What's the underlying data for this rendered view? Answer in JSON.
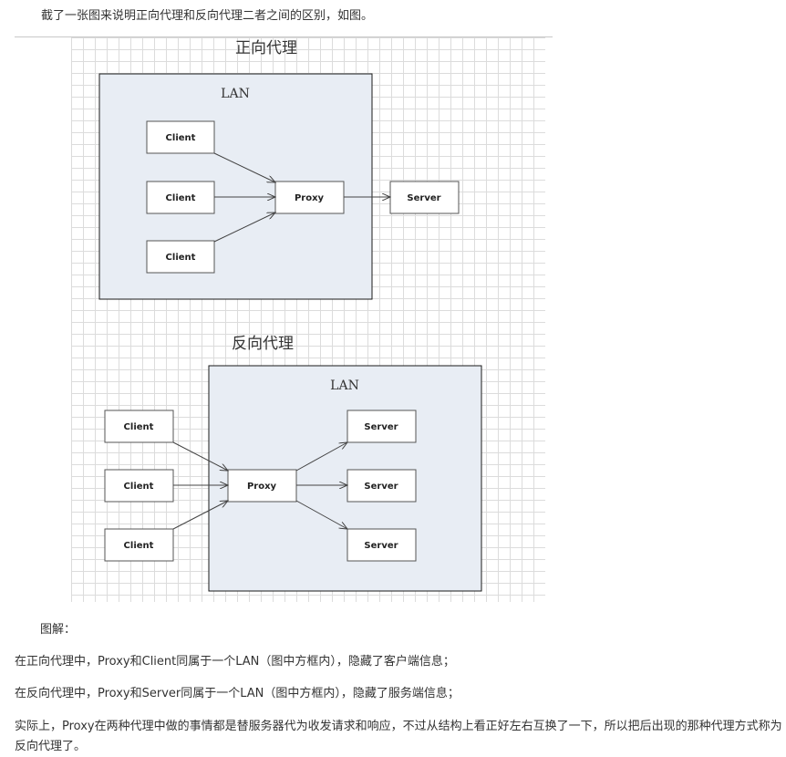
{
  "intro": "截了一张图来说明正向代理和反向代理二者之间的区别，如图。",
  "diagram": {
    "forward": {
      "title": "正向代理",
      "lan_label": "LAN",
      "clients": [
        "Client",
        "Client",
        "Client"
      ],
      "proxy": "Proxy",
      "server": "Server"
    },
    "reverse": {
      "title": "反向代理",
      "lan_label": "LAN",
      "clients": [
        "Client",
        "Client",
        "Client"
      ],
      "proxy": "Proxy",
      "servers": [
        "Server",
        "Server",
        "Server"
      ]
    }
  },
  "caption_heading": "图解：",
  "paragraphs": [
    "在正向代理中，Proxy和Client同属于一个LAN（图中方框内），隐藏了客户端信息；",
    "在反向代理中，Proxy和Server同属于一个LAN（图中方框内），隐藏了服务端信息；",
    "实际上，Proxy在两种代理中做的事情都是替服务器代为收发请求和响应，不过从结构上看正好左右互换了一下，所以把后出现的那种代理方式称为反向代理了。"
  ]
}
